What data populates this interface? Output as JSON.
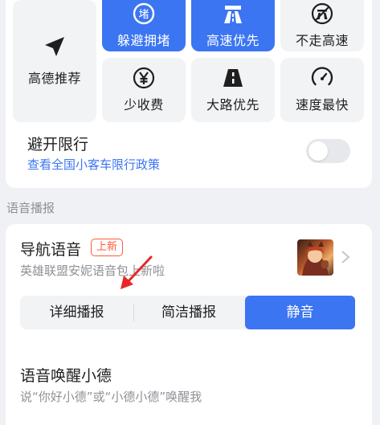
{
  "route_prefs": {
    "recommend": "高德推荐",
    "avoid_jam": "躲避拥堵",
    "highway_first": "高速优先",
    "no_highway": "不走高速",
    "less_toll": "少收费",
    "main_road": "大路优先",
    "fastest": "速度最快"
  },
  "restriction": {
    "label": "避开限行",
    "link": "查看全国小客车限行政策",
    "enabled": false
  },
  "voice_section": {
    "title": "语音播报",
    "nav_voice_label": "导航语音",
    "badge": "上新",
    "nav_voice_sub": "英雄联盟安妮语音包上新啦",
    "modes": [
      "详细播报",
      "简洁播报",
      "静音"
    ],
    "active_mode": "静音",
    "wake_label": "语音唤醒小德",
    "wake_sub": "说“你好小德”或“小德小德”唤醒我"
  },
  "colors": {
    "accent": "#3b75f2",
    "badge": "#ff5a36",
    "arrow": "#e8262a"
  },
  "icons": {
    "recommend": "navigation-arrow-icon",
    "avoid_jam": "congestion-icon",
    "highway_first": "highway-icon",
    "no_highway": "no-highway-icon",
    "less_toll": "yuan-icon",
    "main_road": "road-icon",
    "fastest": "speedometer-icon"
  }
}
